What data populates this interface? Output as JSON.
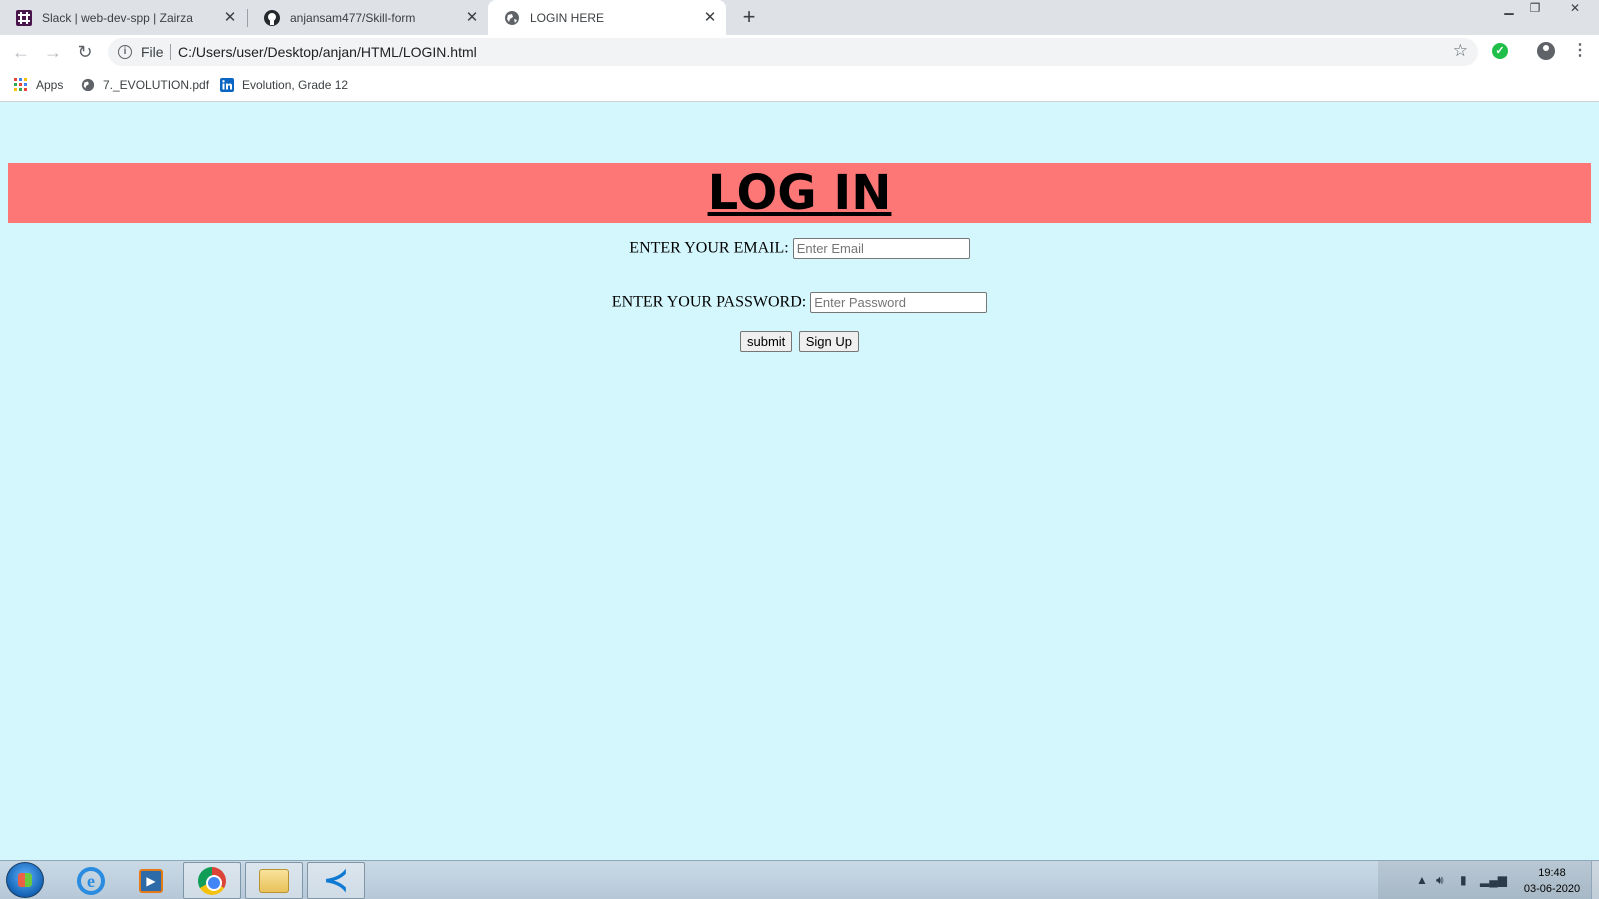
{
  "browser": {
    "tabs": [
      {
        "title": "Slack | web-dev-spp | Zairza",
        "icon": "slack-icon",
        "active": false
      },
      {
        "title": "anjansam477/Skill-form",
        "icon": "github-icon",
        "active": false
      },
      {
        "title": "LOGIN HERE",
        "icon": "globe-icon",
        "active": true
      }
    ],
    "new_tab": "+",
    "omnibox": {
      "scheme_label": "File",
      "url": "C:/Users/user/Desktop/anjan/HTML/LOGIN.html"
    },
    "bookmarks": [
      {
        "label": "Apps",
        "icon": "apps-grid-icon"
      },
      {
        "label": "7._EVOLUTION.pdf",
        "icon": "globe-icon"
      },
      {
        "label": "Evolution, Grade 12",
        "icon": "linkedin-icon"
      }
    ]
  },
  "page": {
    "heading": "LOG IN",
    "email_label": "ENTER YOUR EMAIL:",
    "email_placeholder": "Enter Email",
    "email_value": "",
    "password_label": "ENTER YOUR PASSWORD:",
    "password_placeholder": "Enter Password",
    "password_value": "",
    "submit_label": "submit",
    "signup_label": "Sign Up",
    "colors": {
      "background": "#d4f7fd",
      "banner": "#fe7777"
    }
  },
  "taskbar": {
    "items": [
      "start-orb",
      "internet-explorer-icon",
      "media-player-icon",
      "chrome-icon",
      "file-explorer-icon",
      "vscode-icon"
    ],
    "clock": {
      "time": "19:48",
      "date": "03-06-2020"
    }
  }
}
